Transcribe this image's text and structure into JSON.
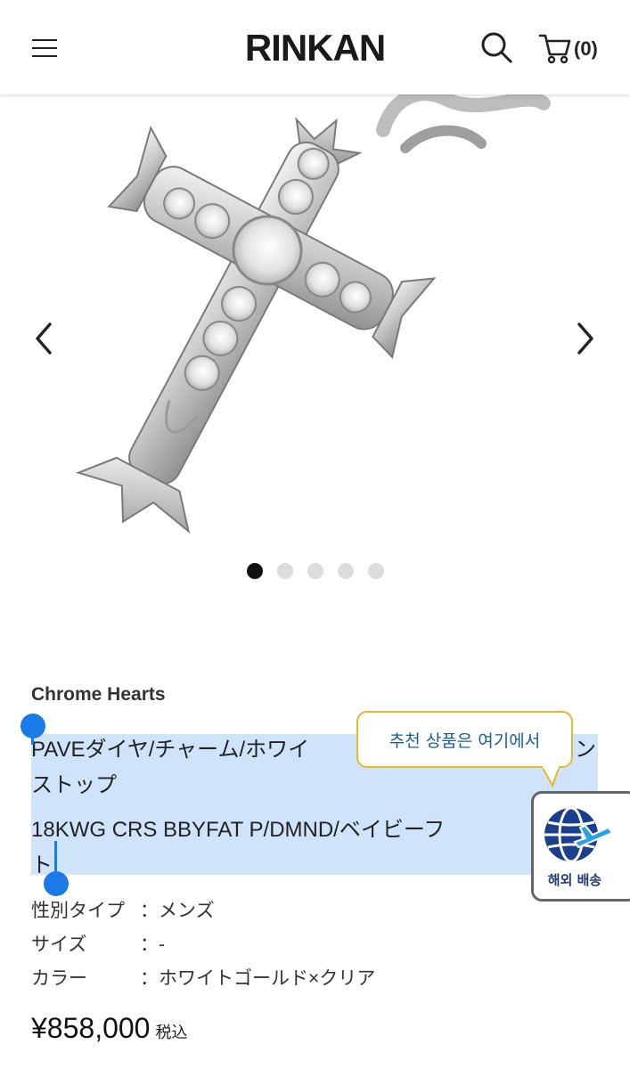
{
  "header": {
    "logo": "RINKAN",
    "cart_count": "(0)",
    "icons": {
      "menu": "hamburger-icon",
      "search": "search-icon",
      "cart": "cart-icon"
    }
  },
  "gallery": {
    "image_alt": "cross charm",
    "slide_count": 5,
    "active_index": 0
  },
  "product": {
    "brand": "Chrome Hearts",
    "name_line1": "PAVEダイヤ/チャーム/ホワイ",
    "name_line1_tail": "ン",
    "name_line2": "ストップ",
    "code_line1": "18KWG CRS BBYFAT P/DMND/ベイビーフ",
    "code_line2": "ト",
    "specs": [
      {
        "key": "性別タイプ",
        "value": "：メンズ"
      },
      {
        "key": "サイズ",
        "value": "：-"
      },
      {
        "key": "カラー",
        "value": "：ホワイトゴールド×クリア"
      }
    ],
    "price": "¥858,000",
    "tax_note": "税込"
  },
  "tooltip": {
    "text": "추천 상품은 여기에서"
  },
  "shipping_widget": {
    "label": "해외 배송"
  },
  "colors": {
    "selection": "#cfe4fb",
    "handle": "#1a7be8",
    "tooltip_border": "#e2b92a",
    "tooltip_text": "#1a5e9a"
  }
}
